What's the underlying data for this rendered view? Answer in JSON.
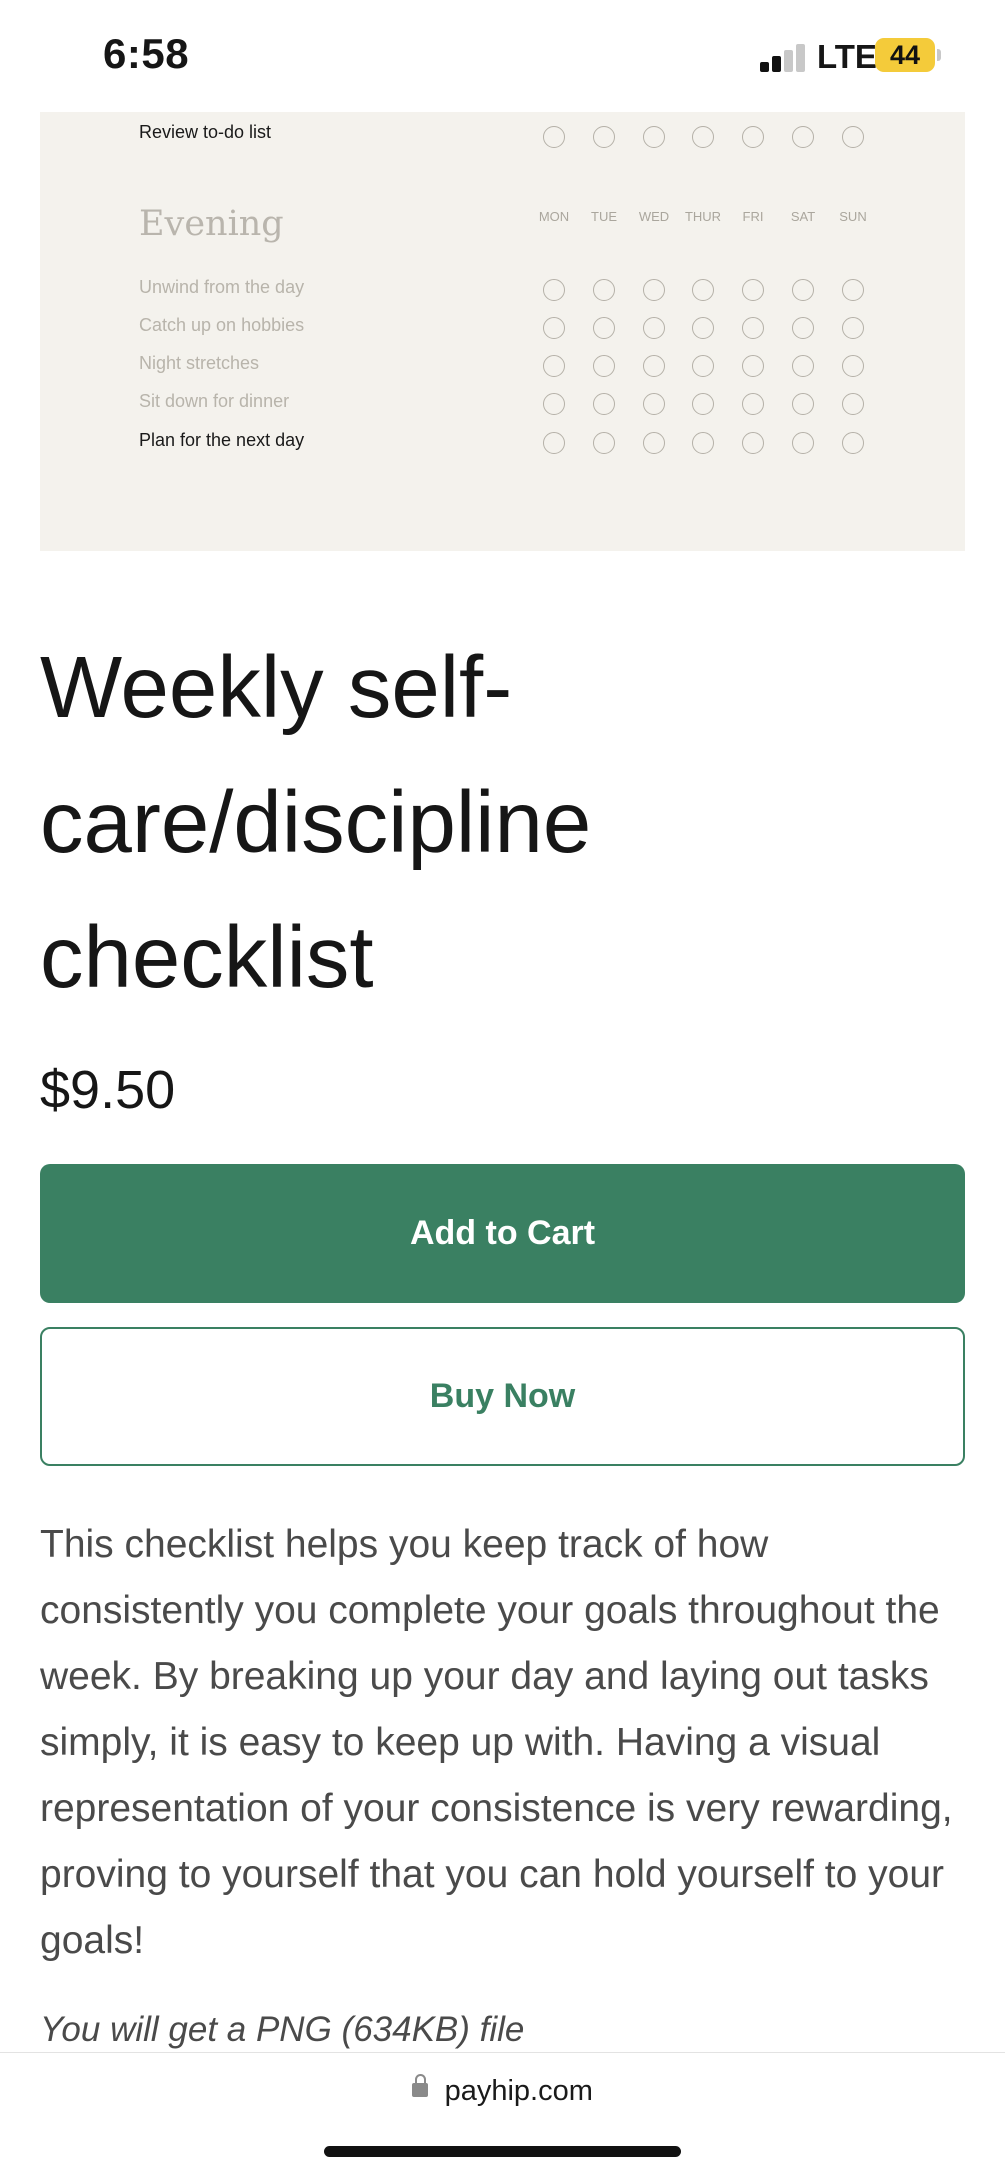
{
  "status_bar": {
    "time": "6:58",
    "network": "LTE",
    "battery": "44"
  },
  "preview": {
    "top_task": "Review to-do list",
    "section_title": "Evening",
    "days": [
      "MON",
      "TUE",
      "WED",
      "THUR",
      "FRI",
      "SAT",
      "SUN"
    ],
    "tasks": [
      "Unwind from the day",
      "Catch up on hobbies",
      "Night stretches",
      "Sit down for dinner",
      "Plan for the next day"
    ]
  },
  "product": {
    "title": "Weekly self-care/discipline checklist",
    "price": "$9.50",
    "add_to_cart_label": "Add to Cart",
    "buy_now_label": "Buy Now",
    "description": "This checklist helps you keep track of how consistently you complete your goals throughout the week. By breaking up your day and laying out tasks simply, it is easy to keep up with. Having a visual representation of your consistence is very rewarding, proving to yourself that you can hold yourself to your goals!",
    "file_info": "You will get a PNG (634KB) file"
  },
  "browser": {
    "url": "payhip.com"
  },
  "colors": {
    "accent": "#3a8062",
    "preview_bg": "#f4f2ed"
  },
  "icons": {
    "lock": "lock-icon",
    "signal": "signal-icon",
    "battery": "battery-icon"
  }
}
